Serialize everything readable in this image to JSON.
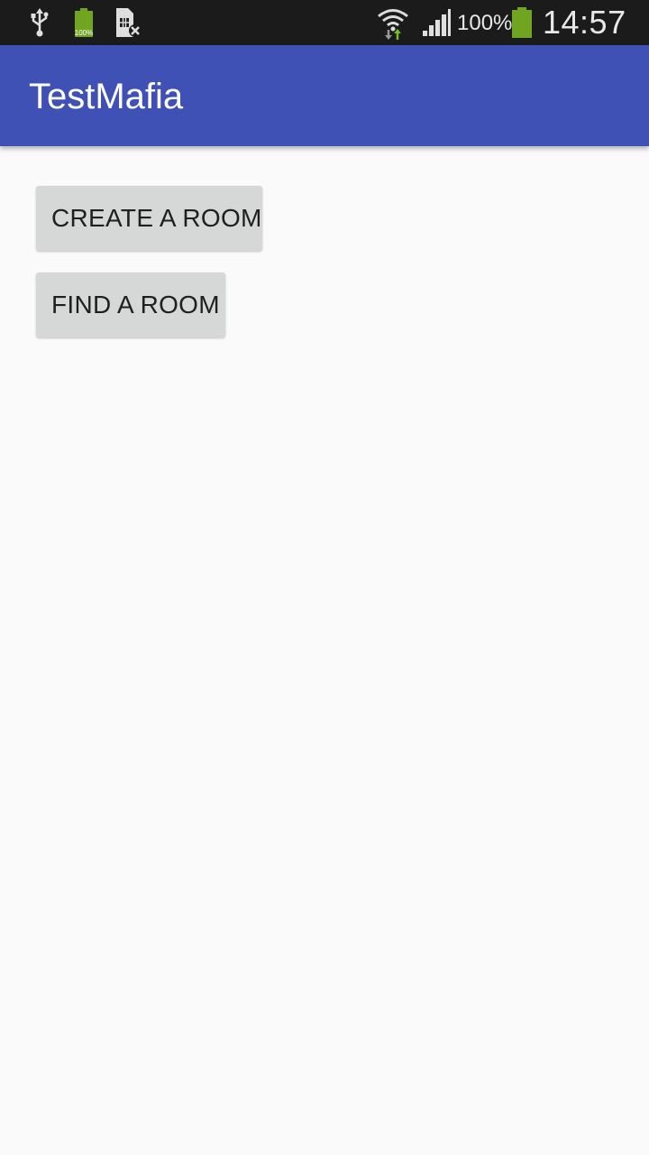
{
  "status_bar": {
    "battery_small_label": "100%",
    "battery_percent": "100%",
    "time": "14:57",
    "icons": [
      "usb-icon",
      "battery-icon",
      "sim-error-icon",
      "wifi-icon",
      "signal-icon",
      "battery-icon"
    ],
    "colors": {
      "background": "#1b1b1b",
      "battery": "#6fa520",
      "text": "#e8e8e8"
    }
  },
  "app_bar": {
    "title": "TestMafia",
    "color": "#3f51b5"
  },
  "buttons": {
    "create_room": "CREATE A ROOM",
    "find_room": "FIND A ROOM"
  }
}
